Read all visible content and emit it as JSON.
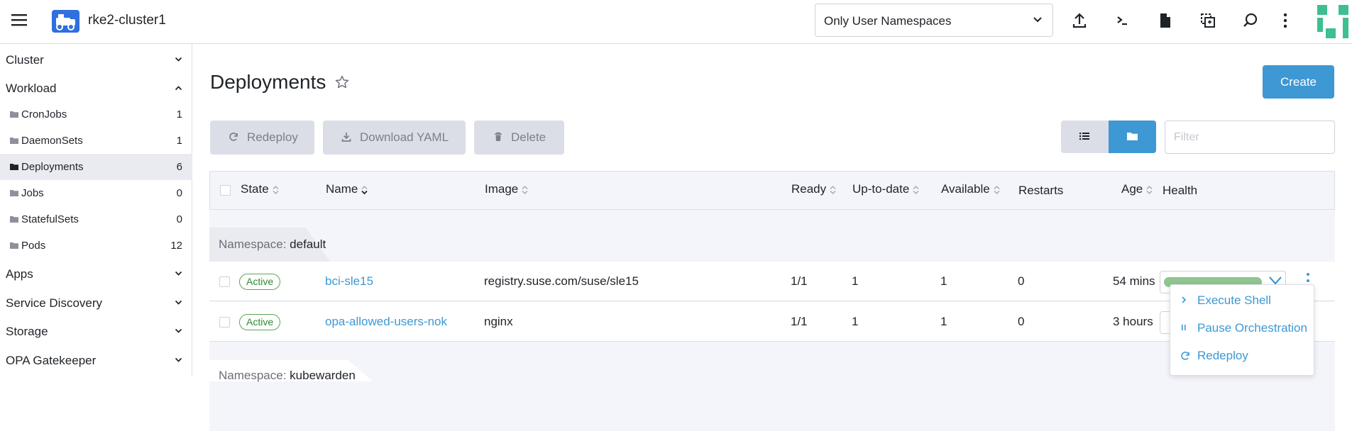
{
  "header": {
    "cluster_name": "rke2-cluster1",
    "namespace_filter": "Only User Namespaces",
    "icons": [
      "menu-icon",
      "cluster-icon",
      "upload-icon",
      "shell-icon",
      "file-icon",
      "copy-icon",
      "search-icon",
      "more-vertical-icon"
    ]
  },
  "sidebar": {
    "groups": [
      {
        "label": "Cluster",
        "expanded": false
      },
      {
        "label": "Workload",
        "expanded": true
      },
      {
        "label": "Apps",
        "expanded": false
      },
      {
        "label": "Service Discovery",
        "expanded": false
      },
      {
        "label": "Storage",
        "expanded": false
      },
      {
        "label": "OPA Gatekeeper",
        "expanded": false
      }
    ],
    "workload_items": [
      {
        "label": "CronJobs",
        "count": "1"
      },
      {
        "label": "DaemonSets",
        "count": "1"
      },
      {
        "label": "Deployments",
        "count": "6",
        "active": true
      },
      {
        "label": "Jobs",
        "count": "0"
      },
      {
        "label": "StatefulSets",
        "count": "0"
      },
      {
        "label": "Pods",
        "count": "12"
      }
    ]
  },
  "main": {
    "title": "Deployments",
    "create_label": "Create",
    "actions": {
      "redeploy": "Redeploy",
      "download": "Download YAML",
      "delete": "Delete"
    },
    "filter_placeholder": "Filter",
    "columns": [
      "State",
      "Name",
      "Image",
      "Ready",
      "Up-to-date",
      "Available",
      "Restarts",
      "Age",
      "Health"
    ],
    "groups": [
      {
        "namespace_key": "Namespace:",
        "namespace": "default",
        "rows": [
          {
            "state": "Active",
            "name": "bci-sle15",
            "image": "registry.suse.com/suse/sle15",
            "ready": "1/1",
            "uptodate": "1",
            "available": "1",
            "restarts": "0",
            "age": "54 mins"
          },
          {
            "state": "Active",
            "name": "opa-allowed-users-nok",
            "image": "nginx",
            "ready": "1/1",
            "uptodate": "1",
            "available": "1",
            "restarts": "0",
            "age": "3 hours"
          }
        ]
      },
      {
        "namespace_key": "Namespace:",
        "namespace": "kubewarden"
      }
    ]
  },
  "action_menu": {
    "items": [
      {
        "label": "Execute Shell",
        "icon": "chevron-right-icon"
      },
      {
        "label": "Pause Orchestration",
        "icon": "pause-icon"
      },
      {
        "label": "Redeploy",
        "icon": "refresh-icon"
      }
    ]
  },
  "colors": {
    "accent": "#3d98d3",
    "active_badge": "#5aa55a",
    "health_bar": "#8fc58f"
  }
}
